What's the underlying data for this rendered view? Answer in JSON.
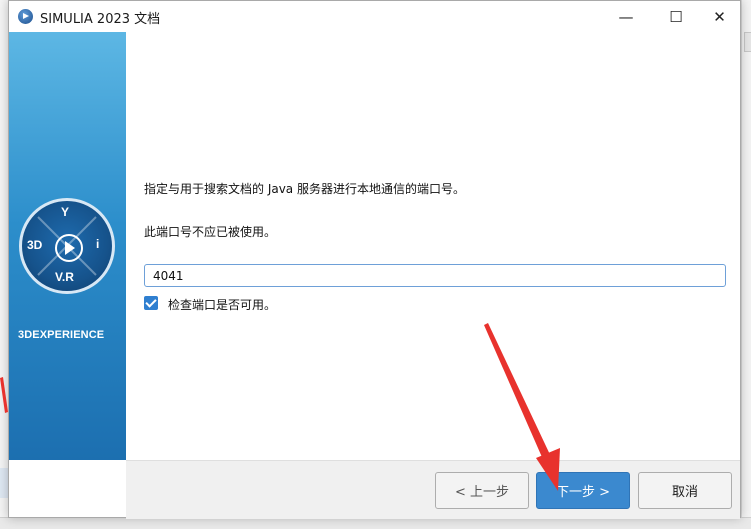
{
  "window": {
    "title": "SIMULIA 2023 文档",
    "controls": {
      "minimize": "—",
      "maximize": "☐",
      "close": "✕"
    }
  },
  "banner": {
    "logo_tags": {
      "top": "Y",
      "left": "3D",
      "right": "i",
      "bottom": "V.R"
    },
    "brand": "3DEXPERIENCE"
  },
  "content": {
    "instruction": "指定与用于搜索文档的 Java 服务器进行本地通信的端口号。",
    "note": "此端口号不应已被使用。",
    "port_value": "4041",
    "check_port": {
      "label": "检查端口是否可用。",
      "checked": true
    }
  },
  "footer": {
    "back_label": "< 上一步",
    "next_label": "下一步 >",
    "cancel_label": "取消"
  },
  "colors": {
    "banner_top": "#5db7e4",
    "banner_bottom": "#1c6fb0",
    "primary_button": "#3b89cf",
    "annotation_arrow": "#e8322d"
  }
}
